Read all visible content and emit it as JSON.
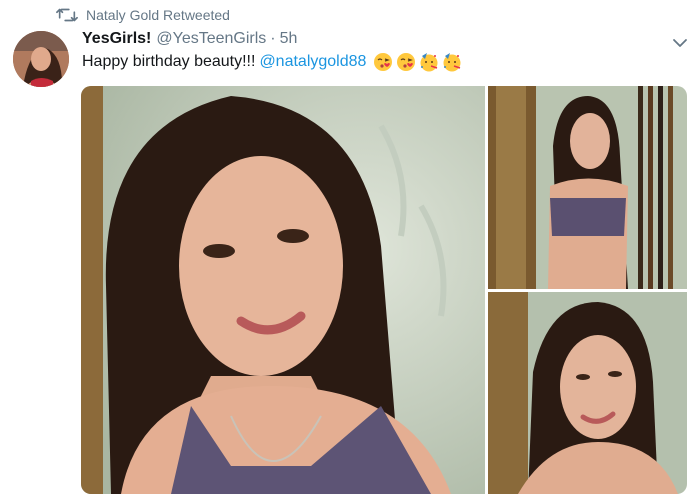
{
  "retweet": {
    "label": "Nataly Gold Retweeted",
    "icon": "retweet-icon"
  },
  "tweet": {
    "display_name": "YesGirls!",
    "handle": "@YesTeenGirls",
    "separator": "·",
    "time": "5h",
    "text": "Happy birthday beauty!!!",
    "mention": "@natalygold88",
    "emojis": [
      "kissing-face-emoji",
      "kissing-face-emoji",
      "party-face-emoji",
      "party-face-emoji"
    ],
    "caret_icon": "chevron-down-icon"
  },
  "media": {
    "count": 3
  },
  "colors": {
    "link": "#1b95e0",
    "muted": "#657786",
    "text": "#14171a"
  }
}
